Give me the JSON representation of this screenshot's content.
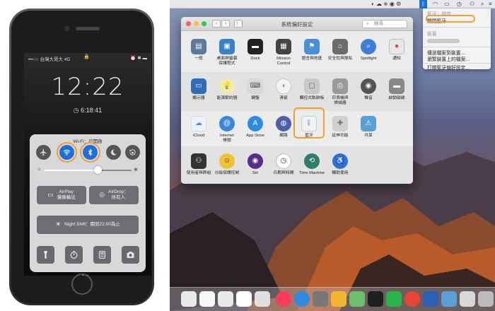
{
  "phone": {
    "carrier": "•••○○ 台灣大哥大  4G",
    "status_icons": "⏰ ✱ ▬",
    "time": "12:22",
    "alarm": "◷ 6:18:41",
    "control_center": {
      "wifi_status": "Wi-Fi：已開啟",
      "airplay_label": "AirPlay\n鏡像輸出",
      "airdrop_label": "AirDrop：\n所有人",
      "night_shift_label": "Night Shift：關到22:00為止",
      "brightness": 0.62
    }
  },
  "menubar": {
    "bt_menu": {
      "status": "藍牙：開啟",
      "toggle_off": "關閉藍牙",
      "devices_header": "裝置",
      "send_file": "傳送檔案到裝置…",
      "browse_files": "瀏覽裝置上的檔案…",
      "open_prefs": "打開藍牙偏好設定…"
    }
  },
  "prefs_window": {
    "title": "系統偏好設定",
    "search_placeholder": "搜尋",
    "row1": [
      "一般",
      "桌面與螢幕\n保護程式",
      "Dock",
      "Mission\nControl",
      "語言與地區",
      "安全性與隱私",
      "Spotlight",
      "通知"
    ],
    "row2": [
      "顯示器",
      "能源節約器",
      "鍵盤",
      "滑鼠",
      "觸控式軌跡板",
      "印表機與\n掃描器",
      "聲音",
      "啟動磁碟"
    ],
    "row3": [
      "iCloud",
      "Internet\n帳號",
      "App Store",
      "網路",
      "藍牙",
      "延伸功能",
      "共享"
    ],
    "row4": [
      "使用者與群組",
      "分級保護控制",
      "Siri",
      "日期與時間",
      "Time Machine",
      "輔助使用"
    ]
  },
  "colors": {
    "highlight": "#f0a030",
    "bluetooth_blue": "#1e6fd9"
  }
}
